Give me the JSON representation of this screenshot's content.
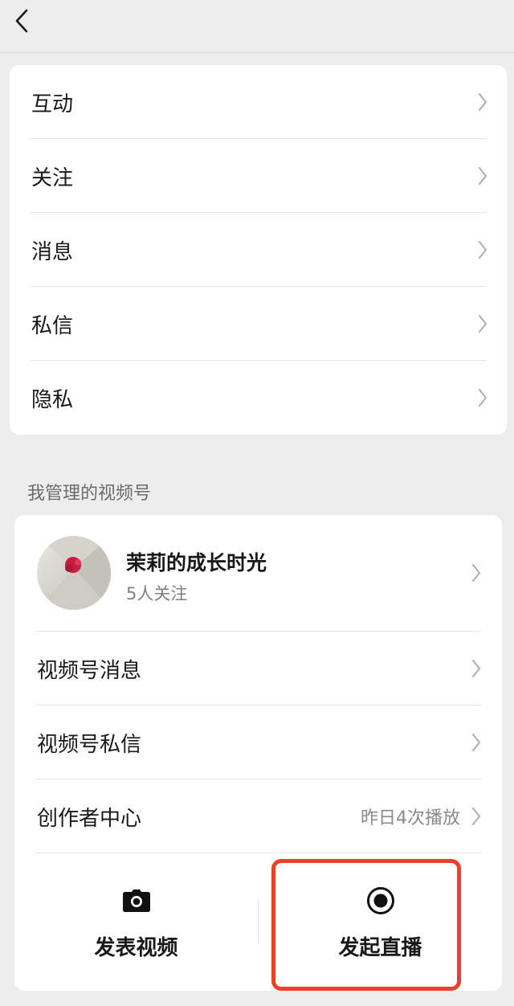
{
  "menu": {
    "items": [
      {
        "label": "互动"
      },
      {
        "label": "关注"
      },
      {
        "label": "消息"
      },
      {
        "label": "私信"
      },
      {
        "label": "隐私"
      }
    ]
  },
  "channels": {
    "section_title": "我管理的视频号",
    "profile": {
      "name": "茉莉的成长时光",
      "followers": "5人关注"
    },
    "rows": [
      {
        "label": "视频号消息",
        "value": ""
      },
      {
        "label": "视频号私信",
        "value": ""
      },
      {
        "label": "创作者中心",
        "value": "昨日4次播放"
      }
    ],
    "actions": {
      "publish_video": "发表视频",
      "start_live": "发起直播"
    }
  },
  "colors": {
    "background": "#ededed",
    "card": "#ffffff",
    "highlight": "#e8412c"
  },
  "icons": {
    "back": "chevron-left-icon",
    "row_arrow": "chevron-right-icon",
    "camera": "camera-icon",
    "live": "live-record-icon"
  }
}
